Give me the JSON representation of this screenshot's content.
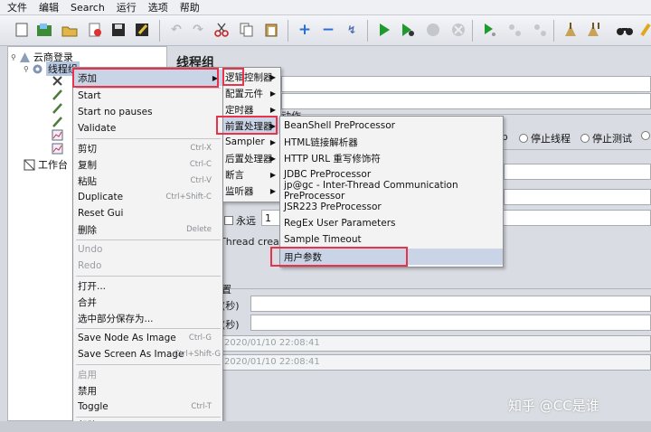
{
  "menubar": [
    "文件",
    "编辑",
    "Search",
    "运行",
    "选项",
    "帮助"
  ],
  "tree": {
    "root": "云商登录",
    "thread_group": "线程组",
    "workbench": "工作台"
  },
  "right": {
    "title": "线程组",
    "action_label": "动作",
    "stop_option_partial": "op",
    "stop_thread": "停止线程",
    "stop_test": "停止测试",
    "forever": "永远",
    "loop_value": "1",
    "thread_creation": "Thread creatio",
    "schedule_label": "置",
    "duration_label": "(秒)",
    "delay_label": "(秒)",
    "start_time": "2020/01/10 22:08:41",
    "end_time": "2020/01/10 22:08:41"
  },
  "context_menu": {
    "add": "添加",
    "start": "Start",
    "start_no_pauses": "Start no pauses",
    "validate": "Validate",
    "cut": "剪切",
    "cut_sc": "Ctrl-X",
    "copy": "复制",
    "copy_sc": "Ctrl-C",
    "paste": "粘贴",
    "paste_sc": "Ctrl-V",
    "duplicate": "Duplicate",
    "duplicate_sc": "Ctrl+Shift-C",
    "reset_gui": "Reset Gui",
    "delete": "删除",
    "delete_sc": "Delete",
    "undo": "Undo",
    "redo": "Redo",
    "open": "打开...",
    "merge": "合并",
    "save_selection": "选中部分保存为...",
    "save_node_image": "Save Node As Image",
    "save_node_image_sc": "Ctrl-G",
    "save_screen_image": "Save Screen As Image",
    "save_screen_image_sc": "Ctrl+Shift-G",
    "enable": "启用",
    "disable": "禁用",
    "toggle": "Toggle",
    "toggle_sc": "Ctrl-T",
    "help": "帮助"
  },
  "add_submenu": {
    "logic_controller": "逻辑控制器",
    "config_element": "配置元件",
    "timer": "定时器",
    "pre_processor": "前置处理器",
    "sampler": "Sampler",
    "post_processor": "后置处理器",
    "assertion": "断言",
    "listener": "监听器"
  },
  "pre_submenu": {
    "items": [
      "BeanShell PreProcessor",
      "HTML链接解析器",
      "HTTP URL 重写修饰符",
      "JDBC PreProcessor",
      "jp@gc - Inter-Thread Communication PreProcessor",
      "JSR223 PreProcessor",
      "RegEx User Parameters",
      "Sample Timeout",
      "用户参数"
    ]
  },
  "watermark": "知乎 @CC是谁",
  "colors": {
    "highlight_box": "#e8334a",
    "menu_highlight": "#c9d4e6",
    "play_green": "#1e9a2e"
  }
}
